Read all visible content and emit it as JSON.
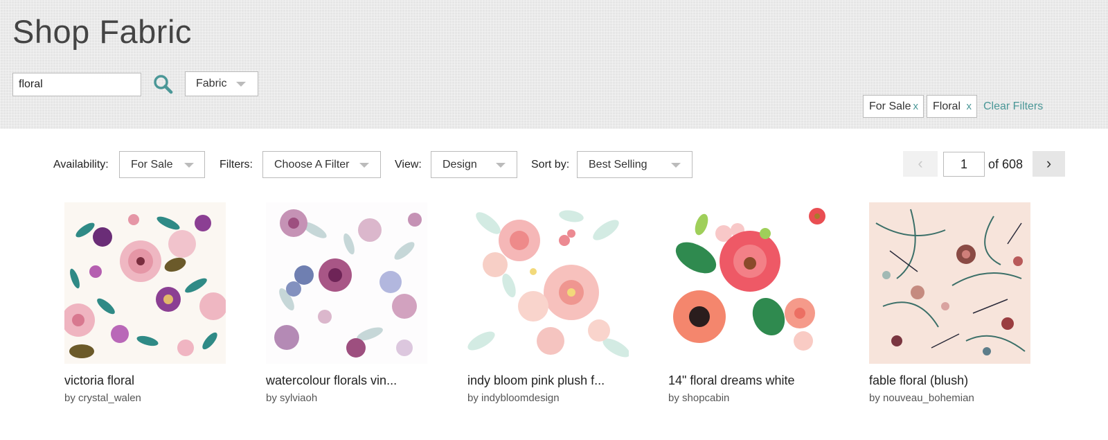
{
  "header": {
    "title": "Shop Fabric",
    "search": {
      "value": "floral",
      "placeholder": ""
    },
    "search_icon": "magnifier-icon",
    "type_select": {
      "value": "Fabric"
    },
    "active_filters": [
      {
        "label": "For Sale",
        "remove": "x"
      },
      {
        "label": "Floral",
        "remove": "x"
      }
    ],
    "clear_filters": "Clear Filters"
  },
  "toolbar": {
    "availability": {
      "label": "Availability:",
      "value": "For Sale"
    },
    "filters": {
      "label": "Filters:",
      "value": "Choose A Filter"
    },
    "view": {
      "label": "View:",
      "value": "Design"
    },
    "sort": {
      "label": "Sort by:",
      "value": "Best Selling"
    }
  },
  "pagination": {
    "prev": "‹",
    "current": "1",
    "of": "of 608",
    "next": "›"
  },
  "products": [
    {
      "title": "victoria floral",
      "author": "by crystal_walen"
    },
    {
      "title": "watercolour florals vin...",
      "author": "by sylviaoh"
    },
    {
      "title": "indy bloom pink plush f...",
      "author": "by indybloomdesign"
    },
    {
      "title": "14\" floral dreams white",
      "author": "by shopcabin"
    },
    {
      "title": "fable floral (blush)",
      "author": "by nouveau_bohemian"
    }
  ],
  "colors": {
    "accent": "#4a9797",
    "header_bg": "#e6e6e6",
    "border": "#bbbbbb"
  }
}
